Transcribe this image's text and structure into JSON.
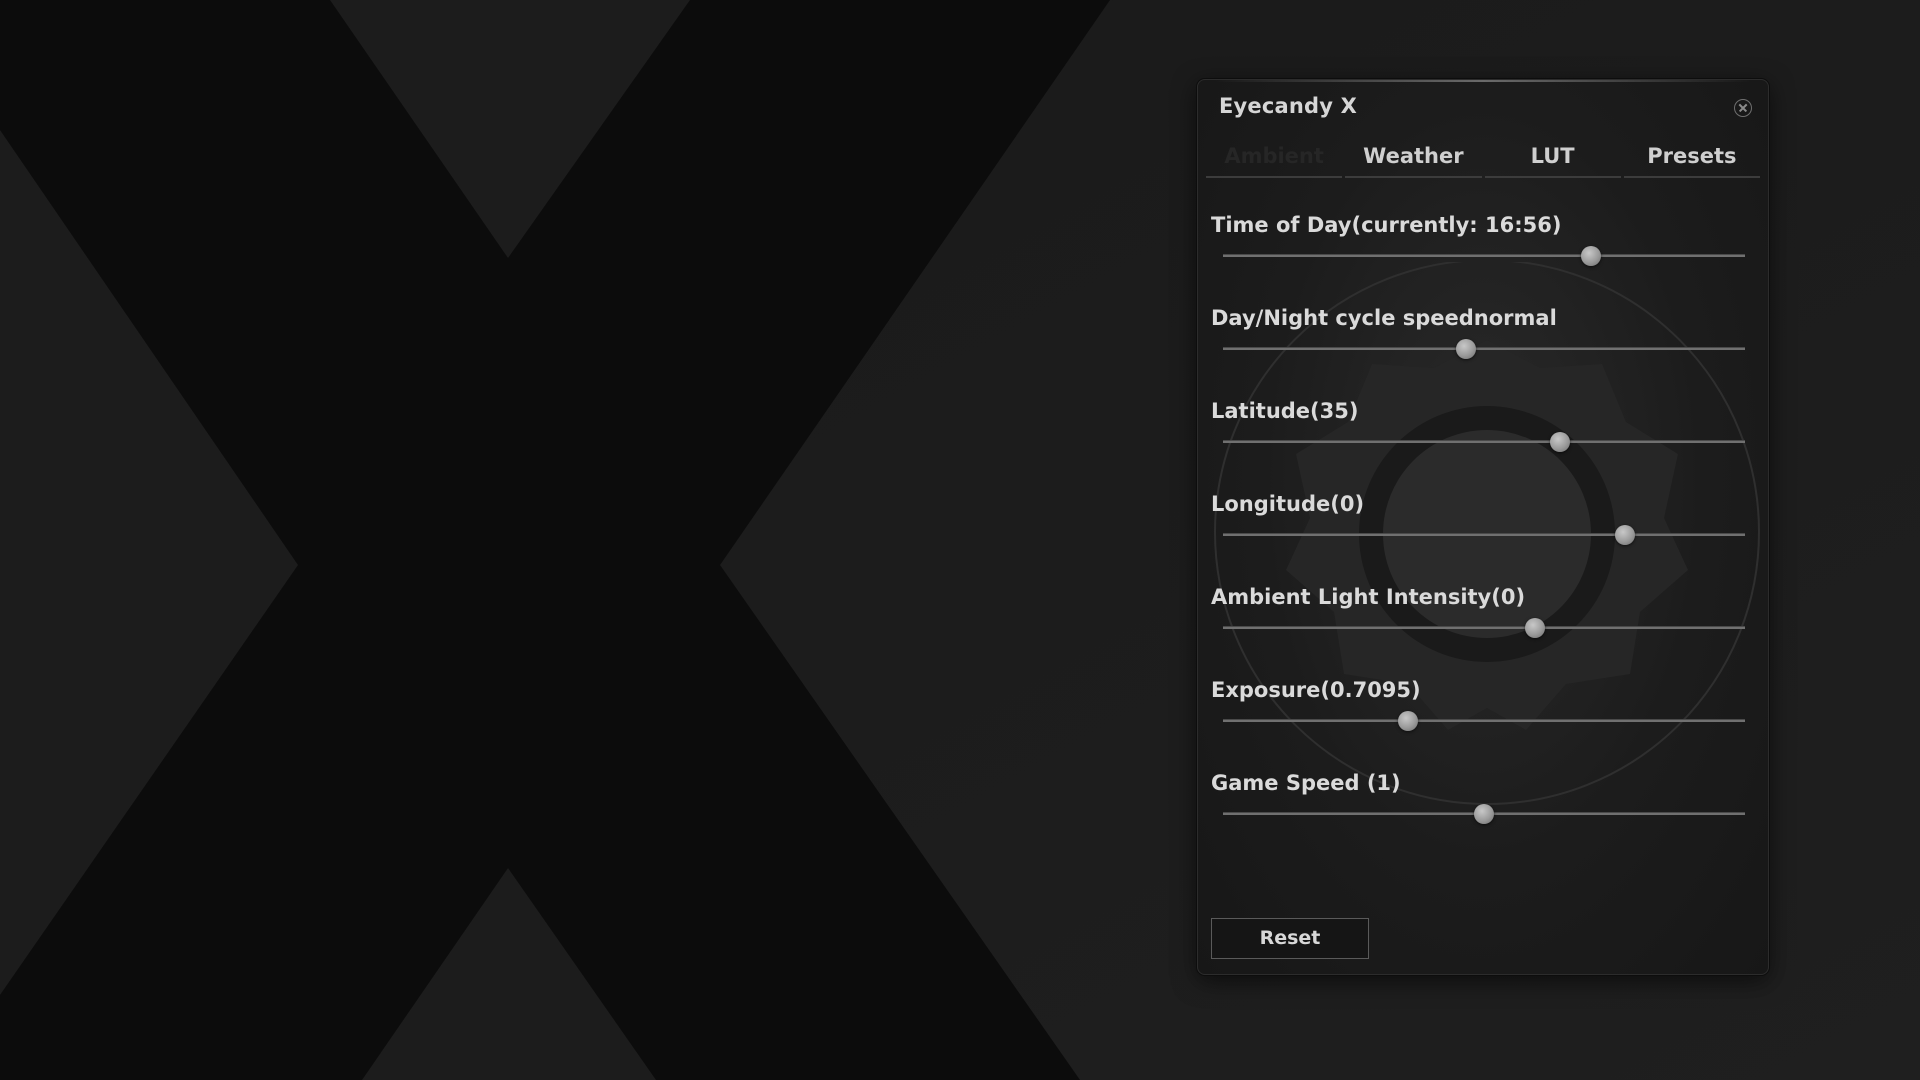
{
  "window": {
    "title": "Eyecandy X",
    "close_icon": "close-circle-icon"
  },
  "tabs": [
    {
      "label": "Ambient",
      "active": true
    },
    {
      "label": "Weather",
      "active": false
    },
    {
      "label": "LUT",
      "active": false
    },
    {
      "label": "Presets",
      "active": false
    }
  ],
  "sliders": [
    {
      "label": "Time of Day(currently: 16:56)",
      "value": 0.705
    },
    {
      "label": "Day/Night cycle speednormal",
      "value": 0.466
    },
    {
      "label": "Latitude(35)",
      "value": 0.645
    },
    {
      "label": "Longitude(0)",
      "value": 0.771
    },
    {
      "label": "Ambient Light Intensity(0)",
      "value": 0.597
    },
    {
      "label": "Exposure(0.7095)",
      "value": 0.355
    },
    {
      "label": "Game Speed (1)",
      "value": 0.5
    }
  ],
  "reset_label": "Reset",
  "colors": {
    "background": "#161616",
    "panel": "#1e1e1e",
    "text": "#dadada",
    "slider_thumb": "#a0a0a0"
  },
  "icons": {
    "background": "x-logo-icon",
    "emblem": "gear-emblem-icon"
  }
}
